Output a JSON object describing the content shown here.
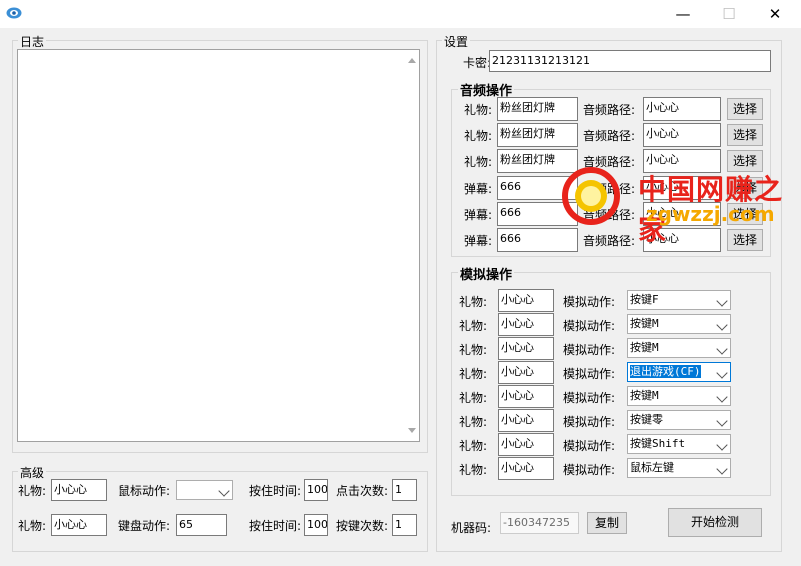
{
  "window": {
    "minimize": "—",
    "maximize": "☐",
    "close": "✕"
  },
  "log": {
    "title": "日志",
    "content": ""
  },
  "settings": {
    "title": "设置",
    "card_label": "卡密:",
    "card_value": "21231131213121",
    "audio": {
      "title": "音频操作",
      "rows": [
        {
          "label": "礼物:",
          "value": "粉丝团灯牌",
          "path_label": "音频路径:",
          "path": "小心心",
          "btn": "选择"
        },
        {
          "label": "礼物:",
          "value": "粉丝团灯牌",
          "path_label": "音频路径:",
          "path": "小心心",
          "btn": "选择"
        },
        {
          "label": "礼物:",
          "value": "粉丝团灯牌",
          "path_label": "音频路径:",
          "path": "小心心",
          "btn": "选择"
        },
        {
          "label": "弹幕:",
          "value": "666",
          "path_label": "音频路径:",
          "path": "小心心",
          "btn": "选择"
        },
        {
          "label": "弹幕:",
          "value": "666",
          "path_label": "音频路径:",
          "path": "小心心",
          "btn": "选择"
        },
        {
          "label": "弹幕:",
          "value": "666",
          "path_label": "音频路径:",
          "path": "小心心",
          "btn": "选择"
        }
      ]
    },
    "sim": {
      "title": "模拟操作",
      "rows": [
        {
          "label": "礼物:",
          "value": "小心心",
          "action_label": "模拟动作:",
          "action": "按键F"
        },
        {
          "label": "礼物:",
          "value": "小心心",
          "action_label": "模拟动作:",
          "action": "按键M"
        },
        {
          "label": "礼物:",
          "value": "小心心",
          "action_label": "模拟动作:",
          "action": "按键M"
        },
        {
          "label": "礼物:",
          "value": "小心心",
          "action_label": "模拟动作:",
          "action": "退出游戏(CF)"
        },
        {
          "label": "礼物:",
          "value": "小心心",
          "action_label": "模拟动作:",
          "action": "按键M"
        },
        {
          "label": "礼物:",
          "value": "小心心",
          "action_label": "模拟动作:",
          "action": "按键零"
        },
        {
          "label": "礼物:",
          "value": "小心心",
          "action_label": "模拟动作:",
          "action": "按键Shift"
        },
        {
          "label": "礼物:",
          "value": "小心心",
          "action_label": "模拟动作:",
          "action": "鼠标左键"
        }
      ]
    },
    "machine_label": "机器码:",
    "machine_code": "-160347235",
    "copy_btn": "复制",
    "start_btn": "开始检测"
  },
  "advanced": {
    "title": "高级",
    "row1": {
      "gift_label": "礼物:",
      "gift": "小心心",
      "mouse_label": "鼠标动作:",
      "mouse": "",
      "hold_label": "按住时间:",
      "hold": "100",
      "click_label": "点击次数:",
      "click": "1"
    },
    "row2": {
      "gift_label": "礼物:",
      "gift": "小心心",
      "key_label": "键盘动作:",
      "key": "65",
      "hold_label": "按住时间:",
      "hold": "100",
      "press_label": "按键次数:",
      "press": "1"
    }
  },
  "watermark": {
    "text_cn": "中国网赚之家",
    "text_en": "zgwzzj.com",
    "accent": "#e8231b"
  }
}
